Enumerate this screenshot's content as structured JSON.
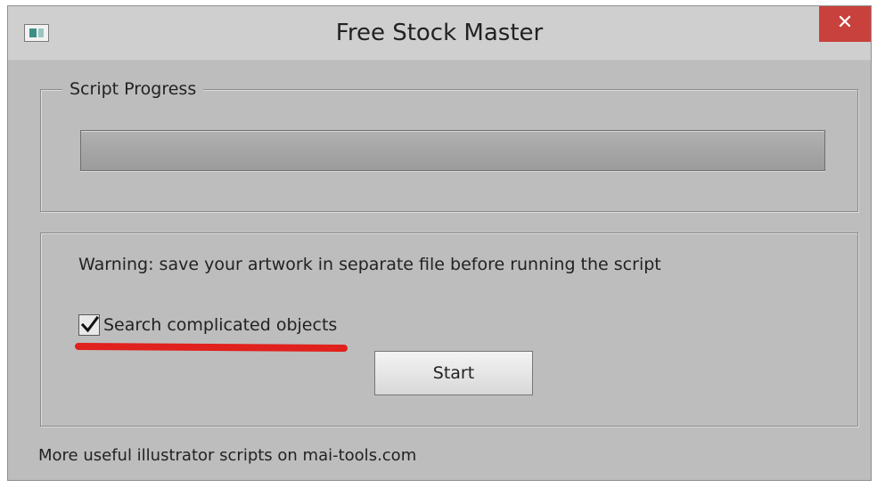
{
  "window": {
    "title": "Free Stock Master",
    "close_label": "✕"
  },
  "progress_group": {
    "legend": "Script Progress",
    "progress_value": 0
  },
  "options_group": {
    "warning_text": "Warning: save your artwork in separate file before running the script",
    "checkbox_label": "Search complicated objects",
    "checkbox_checked": true,
    "start_label": "Start"
  },
  "footer": {
    "text": "More useful illustrator scripts on mai-tools.com"
  },
  "colors": {
    "close_button": "#c9413c",
    "annotation_underline": "#e0211d",
    "window_background": "#bdbdbd"
  },
  "icons": {
    "app": "app-window-icon",
    "close": "close-icon",
    "checkmark": "checkmark-icon"
  }
}
